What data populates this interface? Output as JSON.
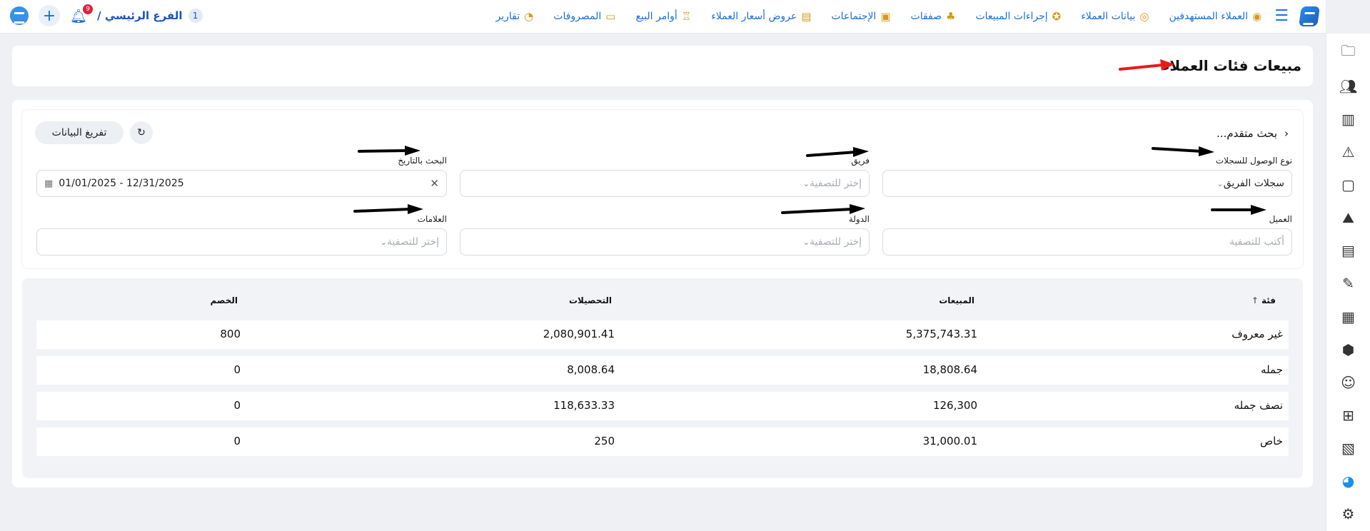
{
  "topbar": {
    "nav": [
      {
        "label": "العملاء المستهدفين",
        "icon": "target-customers-icon"
      },
      {
        "label": "بيانات العملاء",
        "icon": "customer-data-icon"
      },
      {
        "label": "إجراءات المبيعات",
        "icon": "sales-actions-icon"
      },
      {
        "label": "صفقات",
        "icon": "deals-icon"
      },
      {
        "label": "الإجتماعات",
        "icon": "meetings-icon"
      },
      {
        "label": "عروض أسعار العملاء",
        "icon": "quotes-icon"
      },
      {
        "label": "أوامر البيع",
        "icon": "sales-orders-icon"
      },
      {
        "label": "المصروفات",
        "icon": "expenses-icon"
      },
      {
        "label": "تقارير",
        "icon": "reports-icon"
      }
    ],
    "branch_number": "1",
    "branch_label": "الفرع الرئيسي /",
    "notification_count": "9"
  },
  "page": {
    "title": "مبيعات فئات العملاء"
  },
  "filters": {
    "advanced_search": "بحث متقدم...",
    "clear_button": "تفريغ البيانات",
    "access_label": "نوع الوصول للسجلات",
    "access_value": "سجلات الفريق",
    "team_label": "فريق",
    "team_placeholder": "إختر للتصفية",
    "date_label": "البحث بالتاريخ",
    "date_value": "01/01/2025 - 12/31/2025",
    "customer_label": "العميل",
    "customer_placeholder": "أكتب للتصفية",
    "country_label": "الدولة",
    "country_placeholder": "إختر للتصفية",
    "tags_label": "العلامات",
    "tags_placeholder": "إختر للتصفية"
  },
  "table": {
    "columns": [
      "فئة",
      "المبيعات",
      "التحصيلات",
      "الخصم"
    ],
    "rows": [
      [
        "غير معروف",
        "5,375,743.31",
        "2,080,901.41",
        "800"
      ],
      [
        "جمله",
        "18,808.64",
        "8,008.64",
        "0"
      ],
      [
        "نصف جمله",
        "126,300",
        "118,633.33",
        "0"
      ],
      [
        "خاص",
        "31,000.01",
        "250",
        "0"
      ]
    ]
  }
}
